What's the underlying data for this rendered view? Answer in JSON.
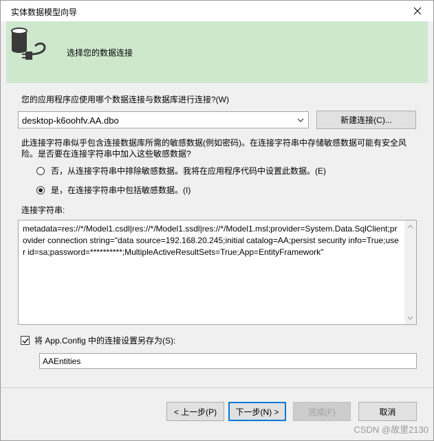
{
  "window": {
    "title": "实体数据模型向导"
  },
  "banner": {
    "title": "选择您的数据连接",
    "icon": "database-connection-icon"
  },
  "question_label": "您的应用程序应使用哪个数据连接与数据库进行连接?(W)",
  "connection_select": {
    "value": "desktop-k6oohfv.AA.dbo"
  },
  "new_connection_button": "新建连接(C)...",
  "warning_text": "此连接字符串似乎包含连接数据库所需的敏感数据(例如密码)。在连接字符串中存储敏感数据可能有安全风险。是否要在连接字符串中加入这些敏感数据?",
  "radio_exclude": {
    "label": "否，从连接字符串中排除敏感数据。我将在应用程序代码中设置此数据。(E)",
    "checked": false
  },
  "radio_include": {
    "label": "是，在连接字符串中包括敏感数据。(I)",
    "checked": true
  },
  "connection_string_label": "连接字符串:",
  "connection_string": "metadata=res://*/Model1.csdl|res://*/Model1.ssdl|res://*/Model1.msl;provider=System.Data.SqlClient;provider connection string=\"data source=192.168.20.245;initial catalog=AA;persist security info=True;user id=sa;password=**********;MultipleActiveResultSets=True;App=EntityFramework\"",
  "save_checkbox": {
    "label": "将 App.Config 中的连接设置另存为(S):",
    "checked": true
  },
  "entity_name": "AAEntities",
  "buttons": {
    "prev": "< 上一步(P)",
    "next": "下一步(N) >",
    "finish": "完成(F)",
    "cancel": "取消"
  },
  "watermark": "CSDN @故里2130",
  "colors": {
    "banner": "#cde8cd",
    "accent": "#0078d7"
  }
}
